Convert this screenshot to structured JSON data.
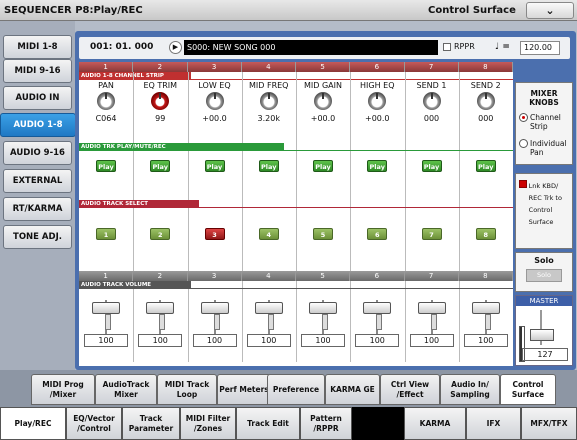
{
  "title": "SEQUENCER P8:Play/REC",
  "page_label": "Control Surface",
  "dropdown_icon": "chevron-down-icon",
  "left_tabs": [
    "MIDI 1-8",
    "MIDI 9-16",
    "AUDIO IN",
    "AUDIO 1-8",
    "AUDIO 9-16",
    "EXTERNAL",
    "RT/KARMA",
    "TONE ADJ."
  ],
  "location": "001: 01. 000",
  "song_name": "S000: NEW SONG 000",
  "rppr_label": "RPPR",
  "tempo_symbol": "♩ =",
  "tempo_value": "120.00",
  "track_numbers": [
    "1",
    "2",
    "3",
    "4",
    "5",
    "6",
    "7",
    "8"
  ],
  "channel_strip_title": "AUDIO 1-8 CHANNEL STRIP",
  "knobs": [
    {
      "label": "PAN",
      "value": "C064"
    },
    {
      "label": "EQ TRIM",
      "value": "99"
    },
    {
      "label": "LOW EQ",
      "value": "+00.0"
    },
    {
      "label": "MID FREQ",
      "value": "3.20k"
    },
    {
      "label": "MID GAIN",
      "value": "+00.0"
    },
    {
      "label": "HIGH EQ",
      "value": "+00.0"
    },
    {
      "label": "SEND 1",
      "value": "000"
    },
    {
      "label": "SEND 2",
      "value": "000"
    }
  ],
  "play_title": "AUDIO TRK PLAY/MUTE/REC",
  "play_label": "Play",
  "select_title": "AUDIO TRACK SELECT",
  "select_labels": [
    "1",
    "2",
    "3",
    "4",
    "5",
    "6",
    "7",
    "8"
  ],
  "selected_track": 3,
  "volume_title": "AUDIO TRACK VOLUME",
  "volumes": [
    "100",
    "100",
    "100",
    "100",
    "100",
    "100",
    "100",
    "100"
  ],
  "mixer_knobs_title": "MIXER KNOBS",
  "mixer_opts": [
    "Channel Strip",
    "Individual Pan"
  ],
  "link_text": "Lnk KBD/ REC Trk to Control Surface",
  "solo_title": "Solo",
  "solo_btn": "Solo",
  "master_title": "MASTER",
  "master_value": "127",
  "bottom_tabs": [
    "MIDI Prog /Mixer",
    "AudioTrack Mixer",
    "MIDI Track Loop",
    "Perf Meters",
    "Preference",
    "KARMA GE",
    "Ctrl View /Effect",
    "Audio In/ Sampling",
    "Control Surface"
  ],
  "main_tabs": [
    "Play/REC",
    "EQ/Vector /Control",
    "Track Parameter",
    "MIDI Filter /Zones",
    "Track Edit",
    "Pattern /RPPR",
    "",
    "KARMA",
    "IFX",
    "MFX/TFX"
  ]
}
